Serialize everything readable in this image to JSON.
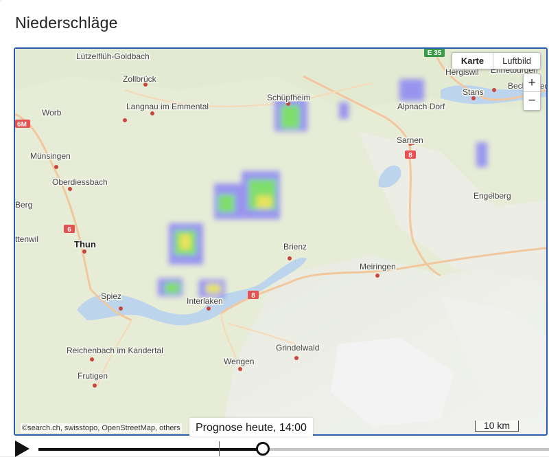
{
  "title": "Niederschläge",
  "map": {
    "layer_toggle": {
      "active": "Karte",
      "other": "Luftbild"
    },
    "zoom": {
      "in": "+",
      "out": "−"
    },
    "attribution": "©search.ch, swisstopo, OpenStreetMap, others",
    "scale": "10 km",
    "road_labels": {
      "e35": "E 35",
      "r6": "6",
      "r8_east": "8",
      "r8_lake": "8",
      "r8_sarnen": "8",
      "a6_west": "6M"
    },
    "places": [
      {
        "name": "Lützelflüh-Goldbach"
      },
      {
        "name": "Zollbrück"
      },
      {
        "name": "Worb"
      },
      {
        "name": "Langnau im Emmental"
      },
      {
        "name": "Schüpfheim"
      },
      {
        "name": "Hergiswil"
      },
      {
        "name": "Ennetbürgen"
      },
      {
        "name": "Beckenried"
      },
      {
        "name": "Stans"
      },
      {
        "name": "Alpnach Dorf"
      },
      {
        "name": "Münsingen"
      },
      {
        "name": "Sarnen"
      },
      {
        "name": "Oberdiessbach"
      },
      {
        "name": "Engelberg"
      },
      {
        "name": "Thun"
      },
      {
        "name": "Brienz"
      },
      {
        "name": "Meiringen"
      },
      {
        "name": "Spiez"
      },
      {
        "name": "Interlaken"
      },
      {
        "name": "Reichenbach im Kandertal"
      },
      {
        "name": "Grindelwald"
      },
      {
        "name": "Wengen"
      },
      {
        "name": "Frutigen"
      },
      {
        "name": "Berg"
      },
      {
        "name": "ttenwil"
      }
    ]
  },
  "timeline": {
    "label": "Prognose heute, 14:00",
    "progress": 0.44
  }
}
